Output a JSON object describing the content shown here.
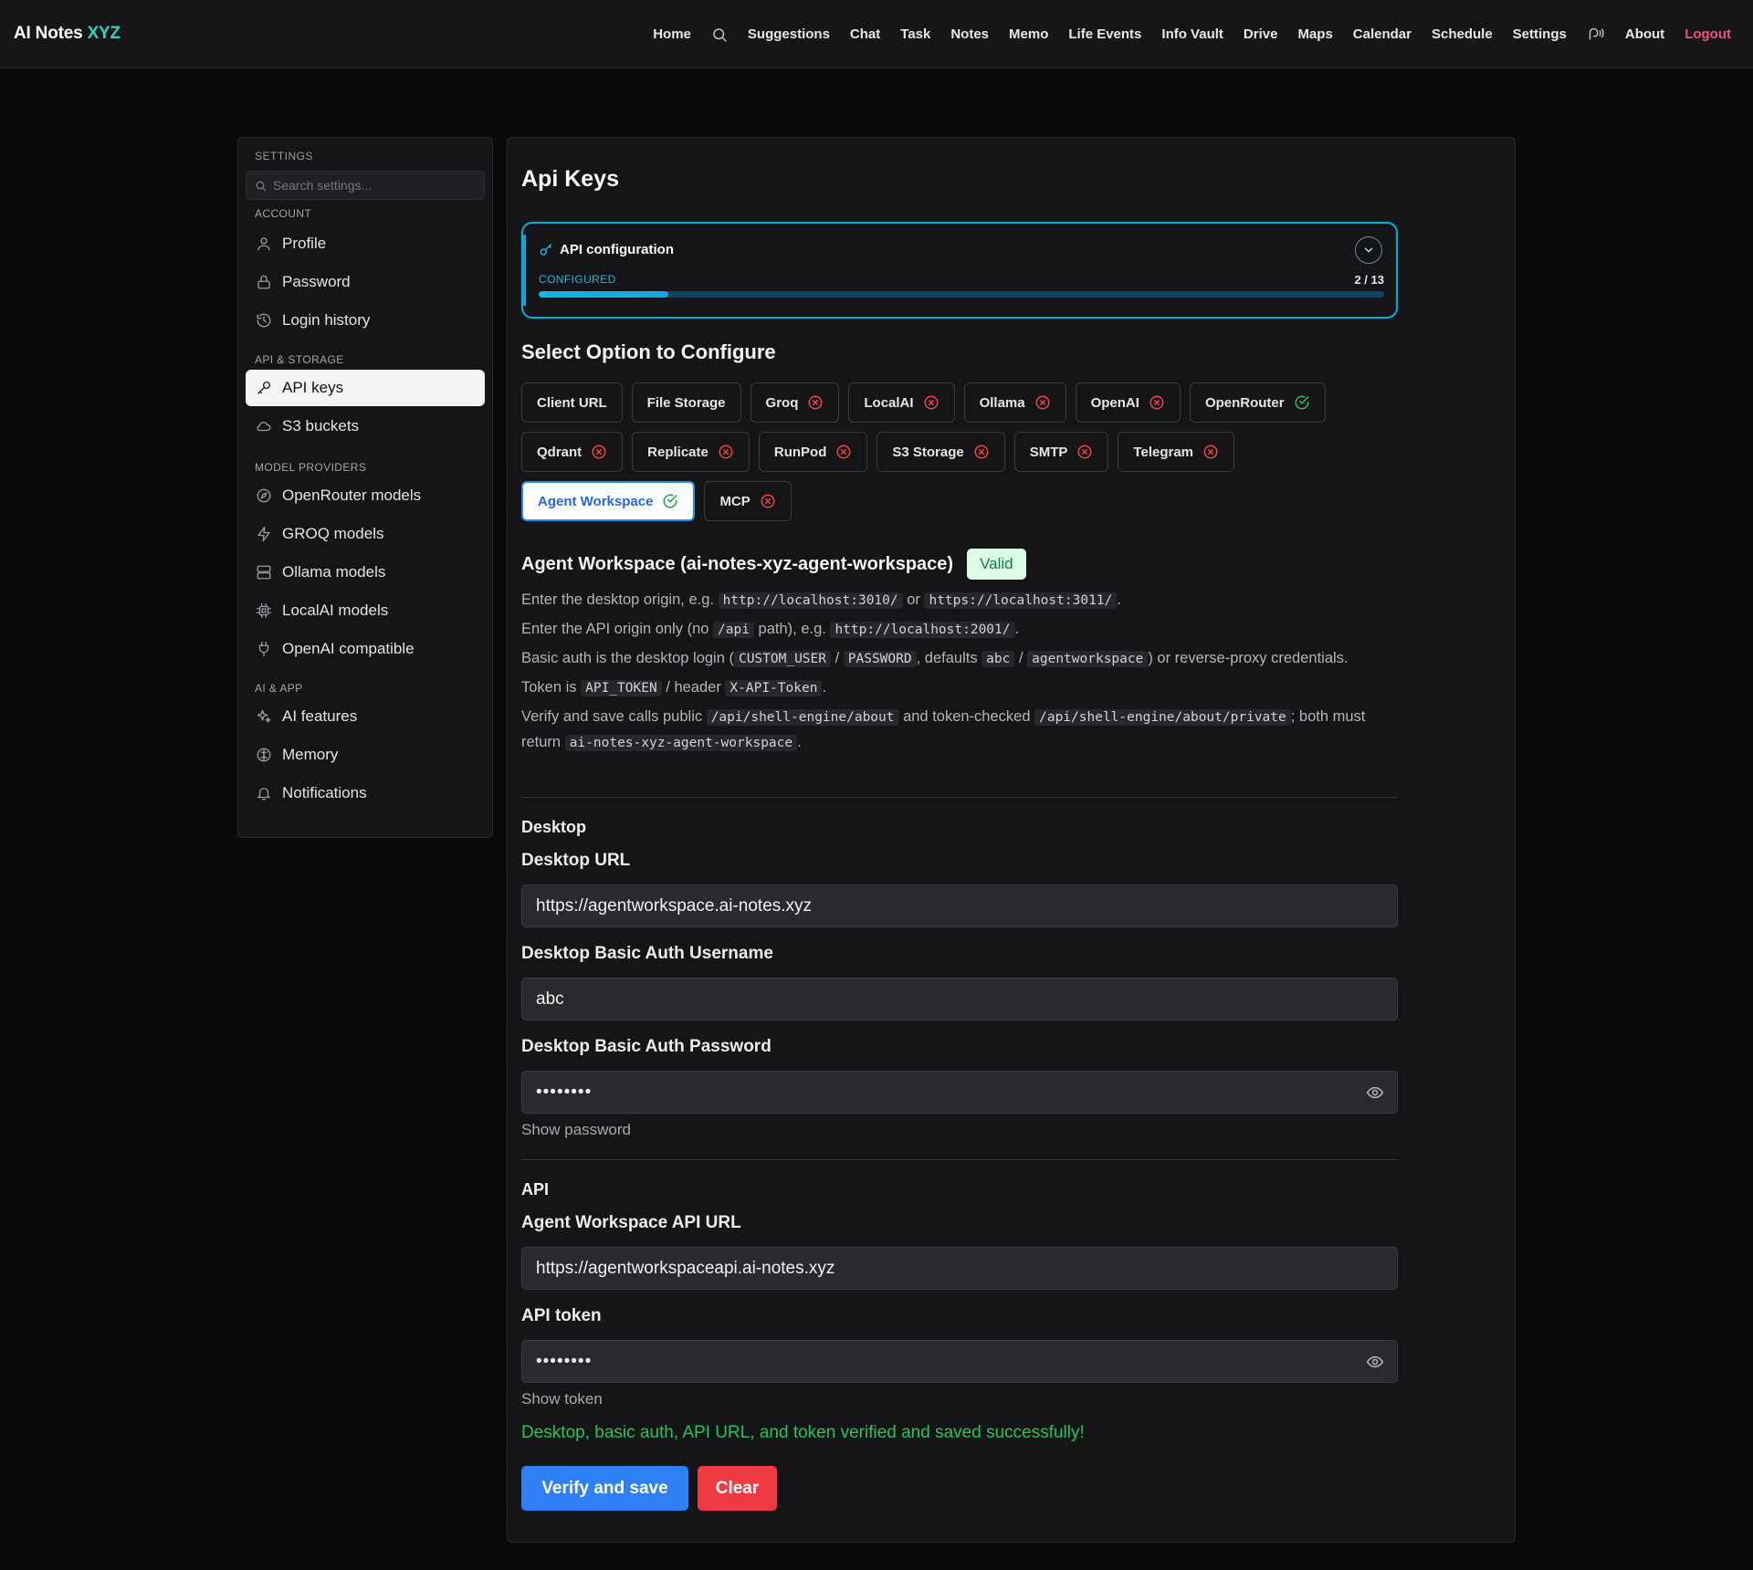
{
  "brand": {
    "name": "AI Notes",
    "accent": "XYZ"
  },
  "nav": {
    "home": "Home",
    "suggestions": "Suggestions",
    "chat": "Chat",
    "task": "Task",
    "notes": "Notes",
    "memo": "Memo",
    "life_events": "Life Events",
    "info_vault": "Info Vault",
    "drive": "Drive",
    "maps": "Maps",
    "calendar": "Calendar",
    "schedule": "Schedule",
    "settings": "Settings",
    "about": "About",
    "logout": "Logout"
  },
  "sidebar": {
    "title": "SETTINGS",
    "search_placeholder": "Search settings...",
    "groups": {
      "account": "ACCOUNT",
      "api_storage": "API & STORAGE",
      "model_providers": "MODEL PROVIDERS",
      "ai_app": "AI & APP"
    },
    "items": {
      "profile": "Profile",
      "password": "Password",
      "login_history": "Login history",
      "api_keys": "API keys",
      "s3_buckets": "S3 buckets",
      "openrouter_models": "OpenRouter models",
      "groq_models": "GROQ models",
      "ollama_models": "Ollama models",
      "localai_models": "LocalAI models",
      "openai_compatible": "OpenAI compatible",
      "ai_features": "AI features",
      "memory": "Memory",
      "notifications": "Notifications"
    }
  },
  "page": {
    "title": "Api Keys",
    "config_card": {
      "title": "API configuration",
      "status": "CONFIGURED",
      "count": "2 / 13",
      "configured": 2,
      "total": 13
    },
    "select_title": "Select Option to Configure",
    "options": {
      "client_url": "Client URL",
      "file_storage": "File Storage",
      "groq": "Groq",
      "localai": "LocalAI",
      "ollama": "Ollama",
      "openai": "OpenAI",
      "openrouter": "OpenRouter",
      "qdrant": "Qdrant",
      "replicate": "Replicate",
      "runpod": "RunPod",
      "s3_storage": "S3 Storage",
      "smtp": "SMTP",
      "telegram": "Telegram",
      "agent_workspace": "Agent Workspace",
      "mcp": "MCP"
    },
    "section": {
      "title": "Agent Workspace (ai-notes-xyz-agent-workspace)",
      "badge": "Valid"
    },
    "desc": {
      "l1_a": "Enter the desktop origin, e.g. ",
      "l1_code1": "http://localhost:3010/",
      "l1_b": " or ",
      "l1_code2": "https://localhost:3011/",
      "l1_c": ".",
      "l2_a": "Enter the API origin only (no ",
      "l2_code1": "/api",
      "l2_b": " path), e.g. ",
      "l2_code2": "http://localhost:2001/",
      "l2_c": ".",
      "l3_a": "Basic auth is the desktop login (",
      "l3_code1": "CUSTOM_USER",
      "l3_b": " / ",
      "l3_code2": "PASSWORD",
      "l3_c": ", defaults ",
      "l3_code3": "abc",
      "l3_d": " / ",
      "l3_code4": "agentworkspace",
      "l3_e": ") or reverse-proxy credentials.",
      "l4_a": "Token is ",
      "l4_code1": "API_TOKEN",
      "l4_b": " / header ",
      "l4_code2": "X-API-Token",
      "l4_c": ".",
      "l5_a": "Verify and save calls public ",
      "l5_code1": "/api/shell-engine/about",
      "l5_b": " and token-checked ",
      "l5_code2": "/api/shell-engine/about/private",
      "l5_c": "; both must return ",
      "l5_code3": "ai-notes-xyz-agent-workspace",
      "l5_d": "."
    },
    "desktop": {
      "group": "Desktop",
      "url_label": "Desktop URL",
      "url_value": "https://agentworkspace.ai-notes.xyz",
      "user_label": "Desktop Basic Auth Username",
      "user_value": "abc",
      "pass_label": "Desktop Basic Auth Password",
      "pass_value": "••••••••",
      "show_password": "Show password"
    },
    "api": {
      "group": "API",
      "url_label": "Agent Workspace API URL",
      "url_value": "https://agentworkspaceapi.ai-notes.xyz",
      "token_label": "API token",
      "token_value": "••••••••",
      "show_token": "Show token"
    },
    "success_message": "Desktop, basic auth, API URL, and token verified and saved successfully!",
    "buttons": {
      "verify": "Verify and save",
      "clear": "Clear"
    }
  },
  "colors": {
    "accent_teal": "#2dd4bf",
    "config_cyan": "#0aa8d8",
    "primary_blue": "#2f80f5",
    "danger_red": "#ef3a44",
    "success_green": "#22c55e",
    "error_red": "#ef4444"
  }
}
